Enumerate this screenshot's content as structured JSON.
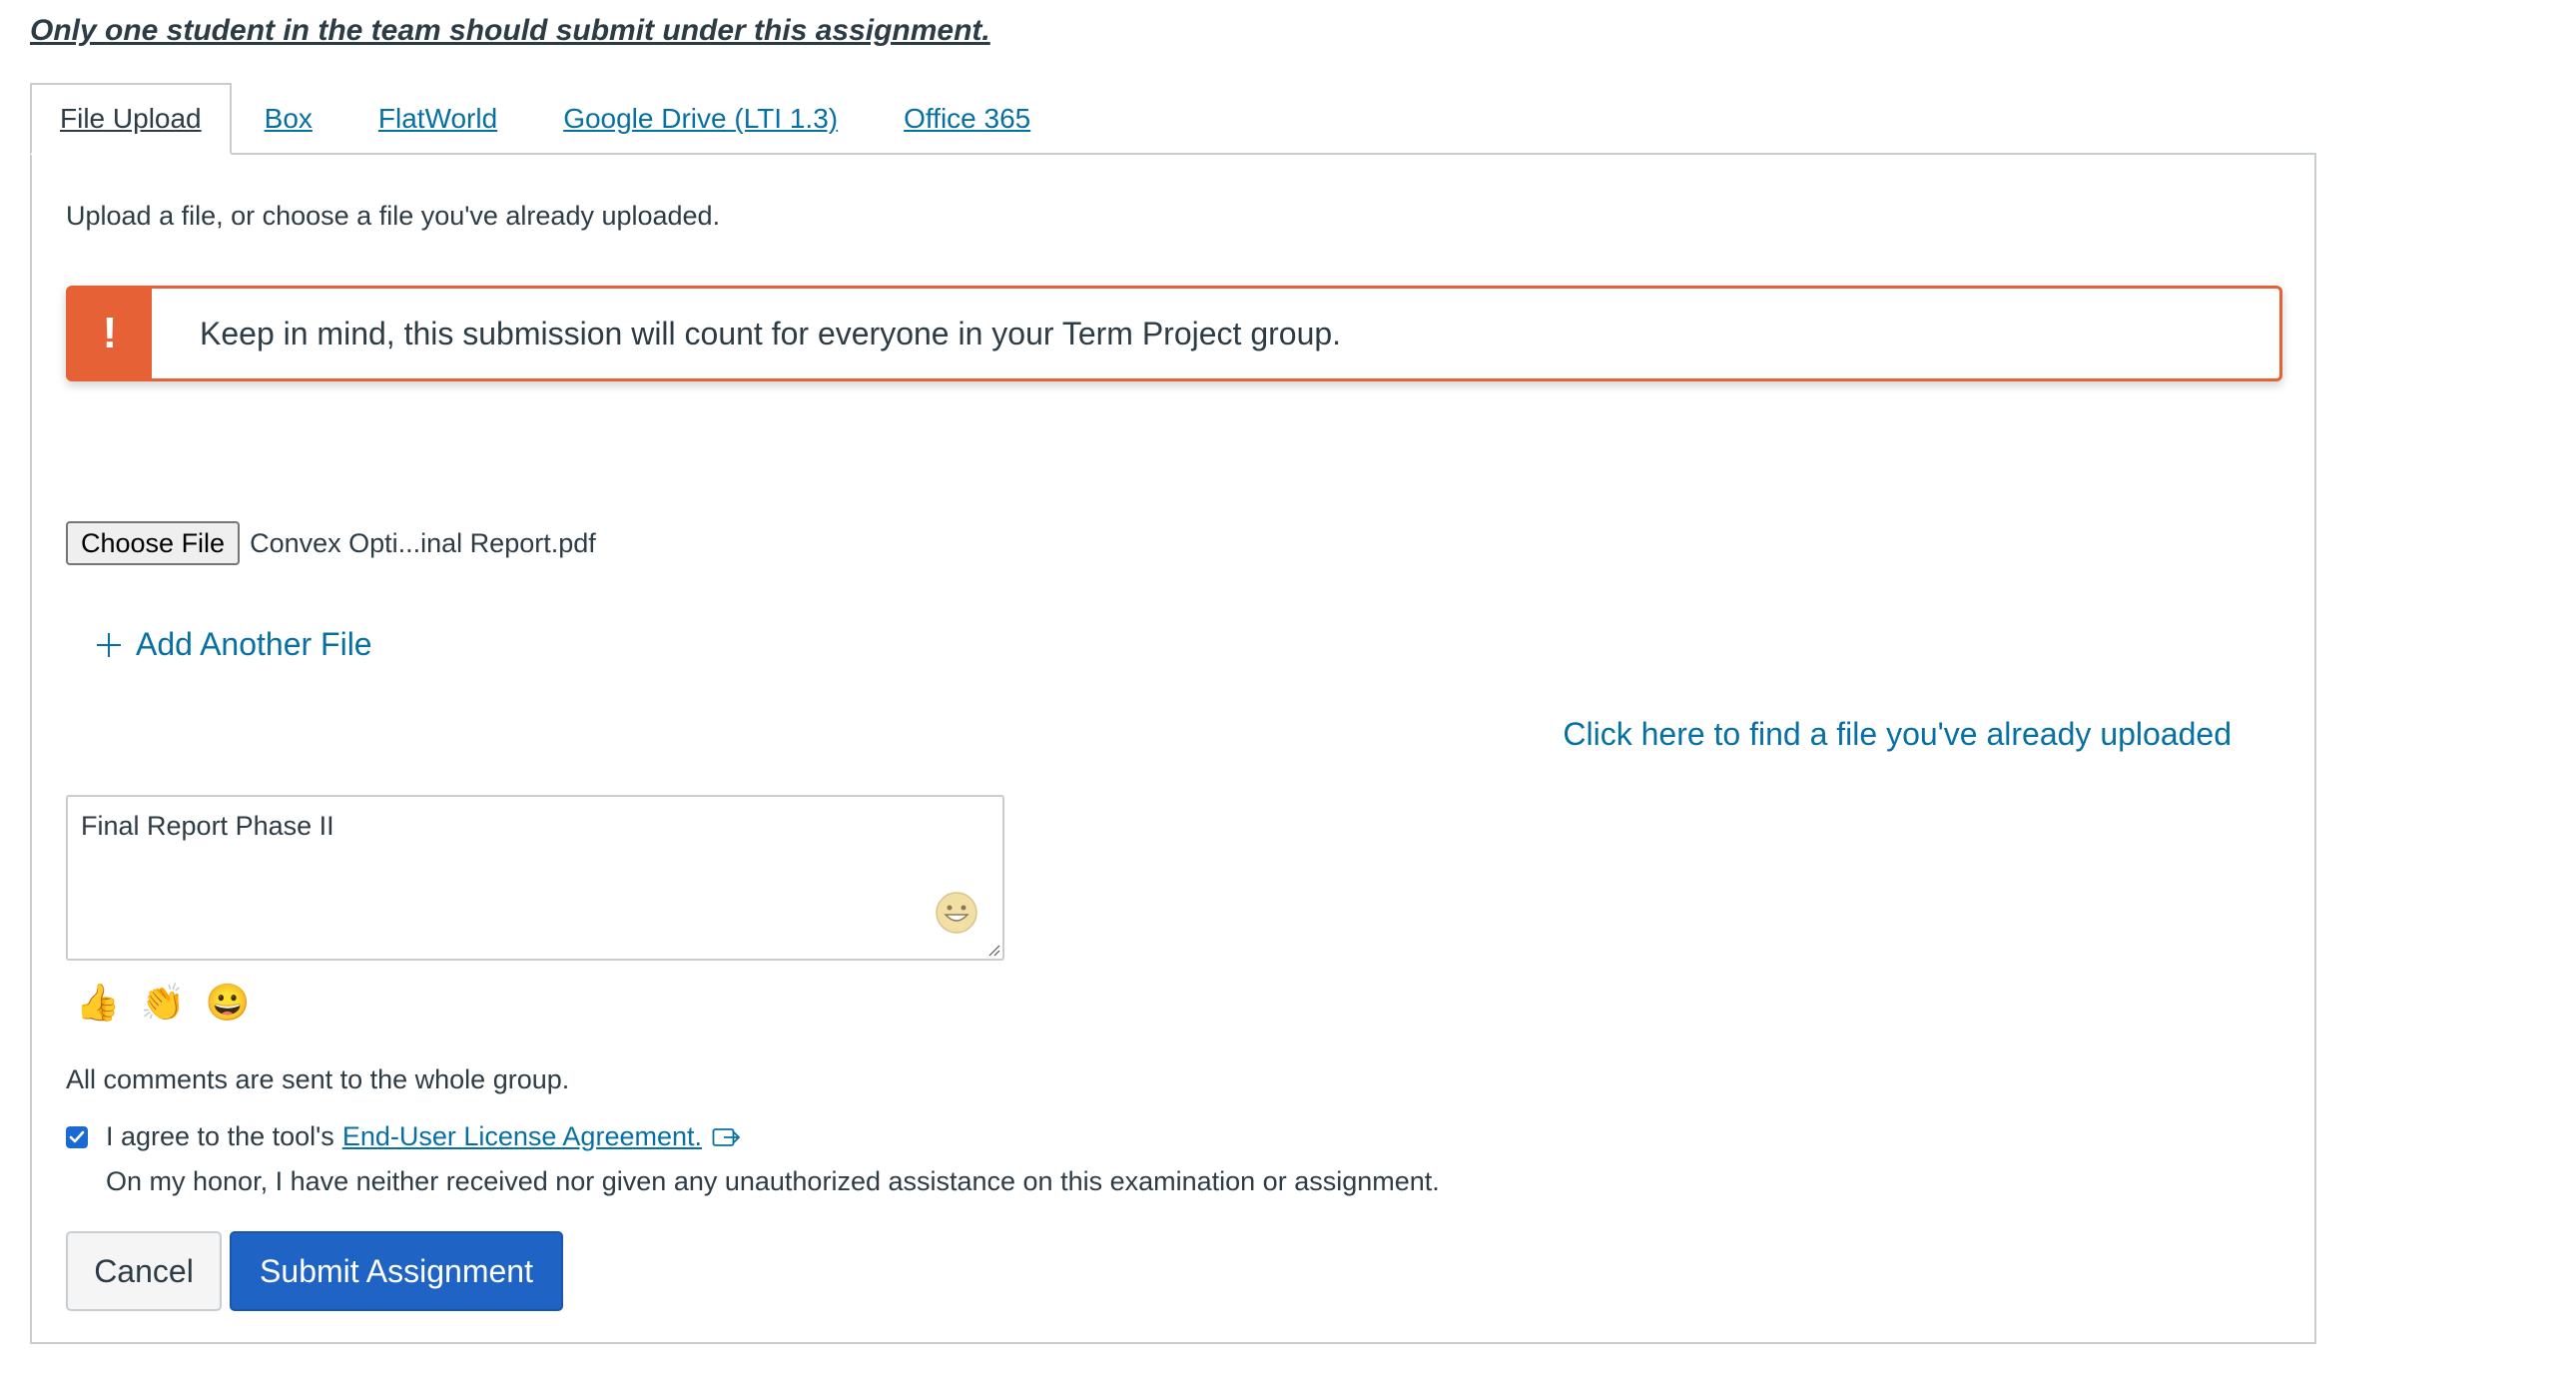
{
  "notice": "Only one student in the team should submit under this assignment.",
  "tabs": [
    {
      "label": "File Upload",
      "active": true
    },
    {
      "label": "Box",
      "active": false
    },
    {
      "label": "FlatWorld",
      "active": false
    },
    {
      "label": "Google Drive (LTI 1.3)",
      "active": false
    },
    {
      "label": "Office 365",
      "active": false
    }
  ],
  "upload": {
    "intro": "Upload a file, or choose a file you've already uploaded.",
    "alert_icon": "!",
    "alert_text": "Keep in mind, this submission will count for everyone in your Term Project group.",
    "choose_file_label": "Choose File",
    "file_name": "Convex Opti...inal Report.pdf",
    "add_file_label": "Add Another File",
    "find_file_link": "Click here to find a file you've already uploaded"
  },
  "comment": {
    "value": "Final Report Phase II",
    "quick_emojis": [
      "thumbs-up-icon",
      "clapping-hands-icon",
      "grinning-face-icon"
    ],
    "group_note": "All comments are sent to the whole group."
  },
  "agreement": {
    "checked": true,
    "prefix": "I agree to the tool's",
    "link": "End-User License Agreement.",
    "honor": "On my honor, I have neither received nor given any unauthorized assistance on this examination or assignment."
  },
  "buttons": {
    "cancel": "Cancel",
    "submit": "Submit Assignment"
  },
  "colors": {
    "link": "#0770a3",
    "alert": "#e66135",
    "primary": "#1f64c5",
    "checkbox": "#1b6ad3"
  }
}
